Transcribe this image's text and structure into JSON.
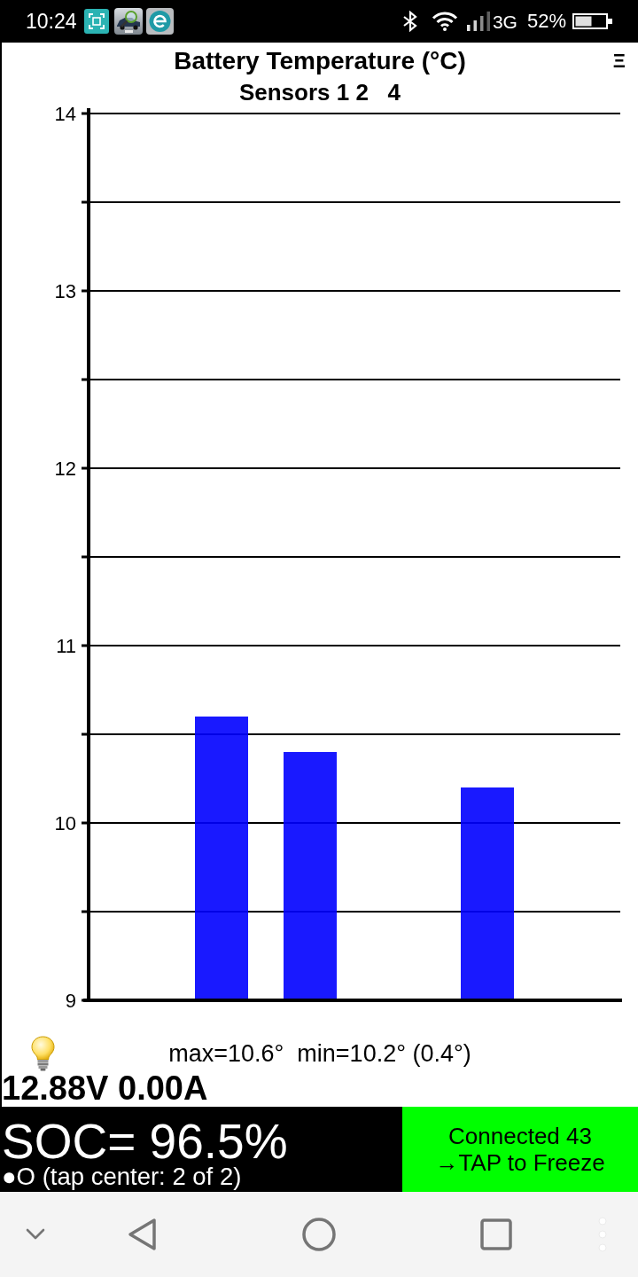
{
  "status_bar": {
    "time": "10:24",
    "network": "3G",
    "battery": "52%"
  },
  "chart": {
    "subtitle": "Sensors 1 2   4",
    "menu": "Ξ",
    "chart_data": {
      "type": "bar",
      "title": "Battery Temperature (°C)",
      "grid": true,
      "ylim": [
        9,
        14
      ],
      "yticks": [
        9,
        10,
        11,
        12,
        13,
        14
      ],
      "series": [
        {
          "color": "#0000ff",
          "values": [
            null,
            10.6,
            10.4,
            null,
            10.2,
            null
          ]
        }
      ]
    }
  },
  "summary": {
    "range": "max=10.6°  min=10.2° (0.4°)",
    "electrical": "12.88V 0.00A"
  },
  "soc": {
    "reading": "SOC= 96.5%",
    "detail": "●O (tap center: 2 of 2)"
  },
  "connection": {
    "status": "Connected 43",
    "action": "→TAP to Freeze"
  }
}
